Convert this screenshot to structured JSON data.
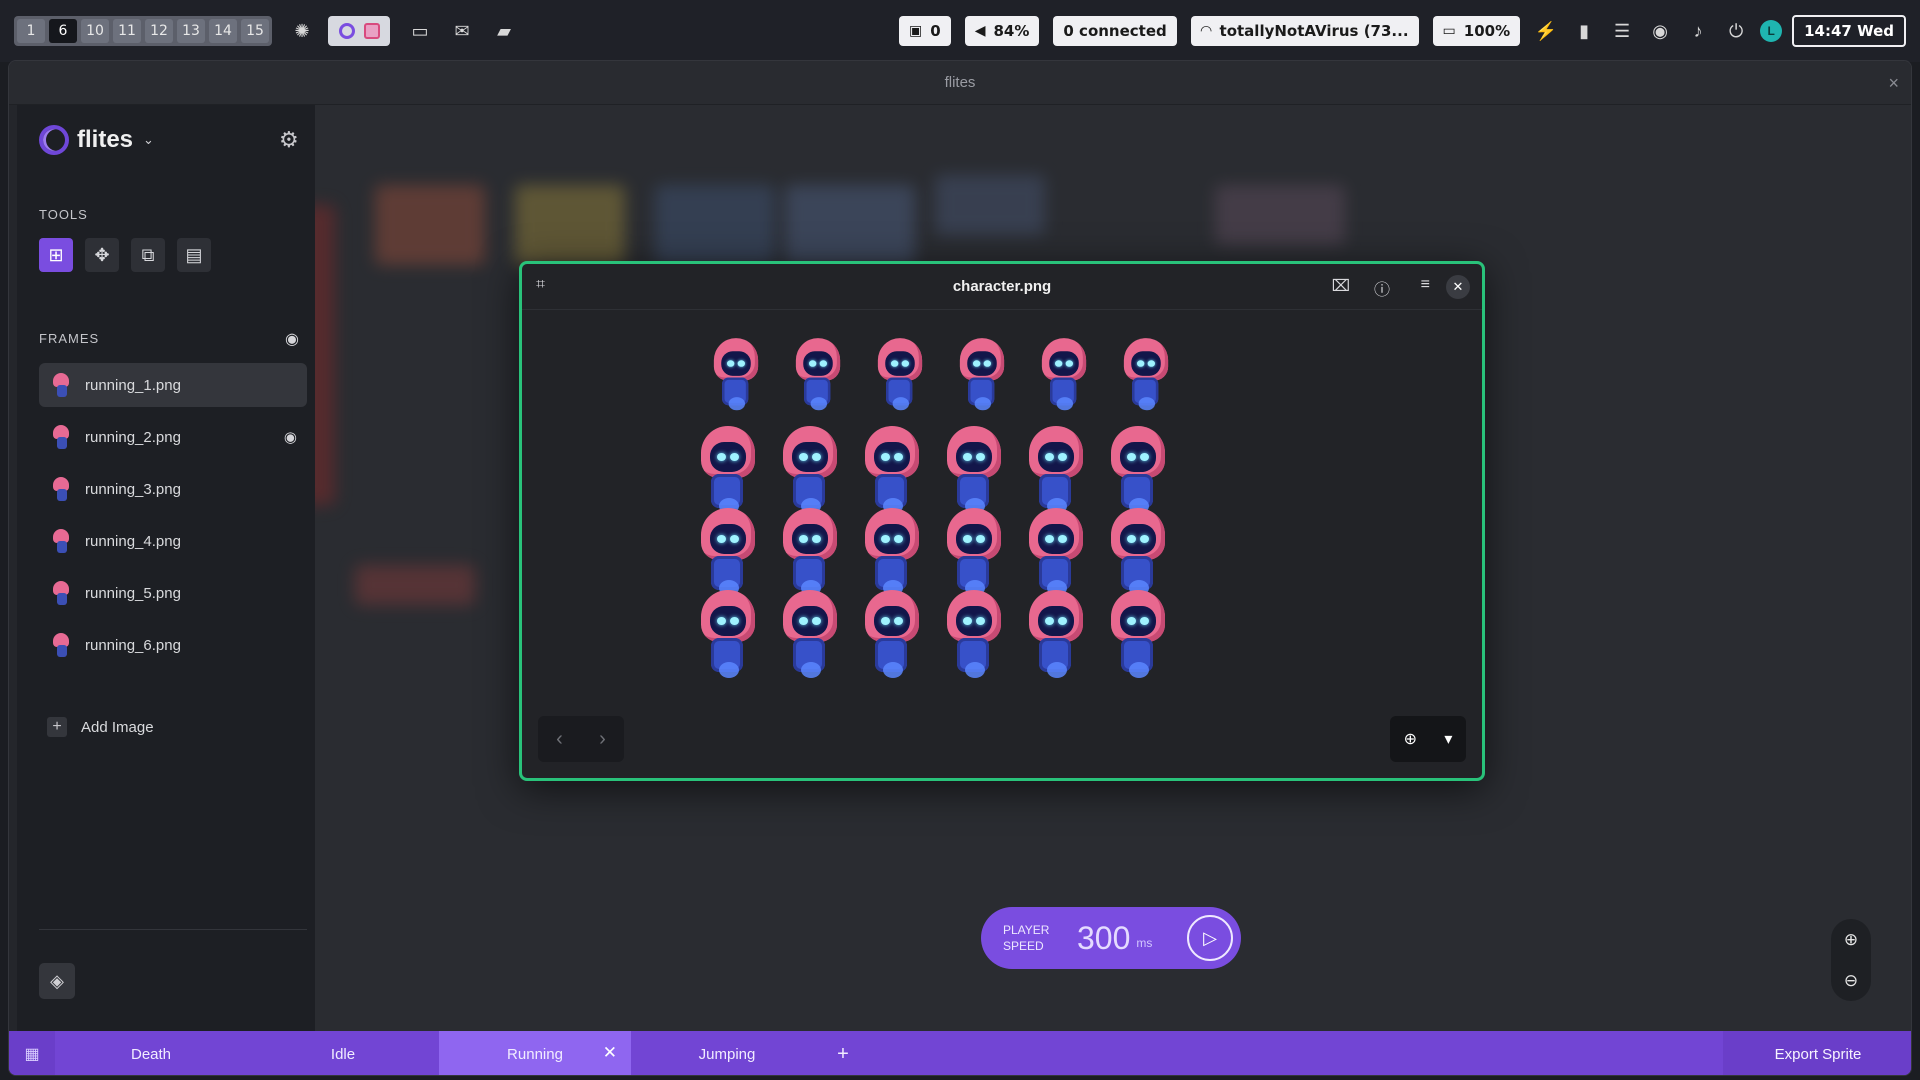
{
  "topbar": {
    "workspaces": [
      "1",
      "6",
      "10",
      "11",
      "12",
      "13",
      "14",
      "15"
    ],
    "active_workspace": "6",
    "indicators": {
      "updates": "0",
      "volume": "84%",
      "vpn": "0 connected",
      "wifi": "totallyNotAVirus (73...",
      "battery": "100%"
    },
    "clock": "14:47 Wed",
    "avatar_letter": "L"
  },
  "window": {
    "title": "flites",
    "close_icon": "×"
  },
  "sidebar": {
    "app_name": "flites",
    "tools_label": "TOOLS",
    "frames_label": "FRAMES",
    "frames": [
      {
        "label": "running_1.png",
        "selected": true,
        "eye": false
      },
      {
        "label": "running_2.png",
        "selected": false,
        "eye": true
      },
      {
        "label": "running_3.png",
        "selected": false,
        "eye": false
      },
      {
        "label": "running_4.png",
        "selected": false,
        "eye": false
      },
      {
        "label": "running_5.png",
        "selected": false,
        "eye": false
      },
      {
        "label": "running_6.png",
        "selected": false,
        "eye": false
      }
    ],
    "add_image_label": "Add Image"
  },
  "dialog": {
    "title": "character.png",
    "rows": 4,
    "cols": 6
  },
  "player": {
    "label_line1": "PLAYER",
    "label_line2": "SPEED",
    "value": "300",
    "unit": "ms"
  },
  "tabs": {
    "items": [
      {
        "label": "Death",
        "active": false
      },
      {
        "label": "Idle",
        "active": false
      },
      {
        "label": "Running",
        "active": true
      },
      {
        "label": "Jumping",
        "active": false
      }
    ],
    "export_label": "Export Sprite"
  },
  "colors": {
    "accent": "#7a4de0",
    "dialog_border": "#29c27a",
    "sprite_hood": "#e8688f",
    "sprite_body": "#3751c9"
  }
}
